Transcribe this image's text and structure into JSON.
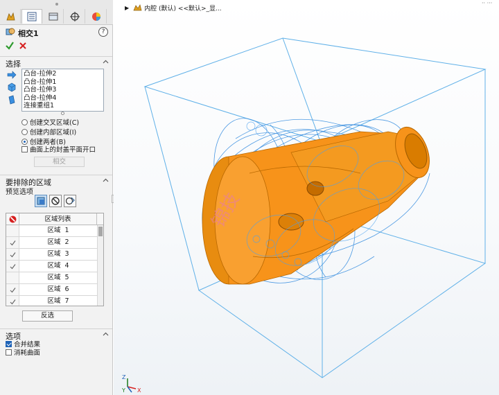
{
  "panel": {
    "title": "相交1",
    "help": "?",
    "tabs": [
      "feature-manager-icon",
      "property-manager-icon",
      "configuration-manager-icon",
      "dimxpert-icon",
      "display-manager-icon"
    ],
    "selection": {
      "header": "选择",
      "items": [
        "凸台-拉伸2",
        "凸台-拉伸1",
        "凸台-拉伸3",
        "凸台-拉伸4",
        "连接重组1"
      ],
      "options": [
        {
          "label": "创建交叉区域(C)",
          "selected": false
        },
        {
          "label": "创建内部区域(I)",
          "selected": false
        },
        {
          "label": "创建两者(B)",
          "selected": true
        }
      ],
      "cap_planar": {
        "label": "曲面上的封盖平面开口",
        "checked": false
      },
      "intersect_button": "相交"
    },
    "exclude": {
      "header": "要排除的区域",
      "preview_label": "预览选项",
      "table_header": "区域列表",
      "rows": [
        {
          "label": "区域",
          "num": "1",
          "checked": false
        },
        {
          "label": "区域",
          "num": "2",
          "checked": true
        },
        {
          "label": "区域",
          "num": "3",
          "checked": true
        },
        {
          "label": "区域",
          "num": "4",
          "checked": true
        },
        {
          "label": "区域",
          "num": "5",
          "checked": false
        },
        {
          "label": "区域",
          "num": "6",
          "checked": true
        },
        {
          "label": "区域",
          "num": "7",
          "checked": true
        }
      ],
      "flip_button": "反选"
    },
    "options": {
      "header": "选项",
      "merge": {
        "label": "合并结果",
        "checked": true
      },
      "consume": {
        "label": "消耗曲面",
        "checked": false
      }
    }
  },
  "viewport": {
    "breadcrumb": "内腔 (默认) <<默认>_显...",
    "watermark": "锦技",
    "triad": {
      "z": "Z",
      "x": "X",
      "y": "Y"
    },
    "colors": {
      "part": "#f7931a",
      "wire": "#3a8fe0",
      "box": "#5fb0e8"
    }
  }
}
